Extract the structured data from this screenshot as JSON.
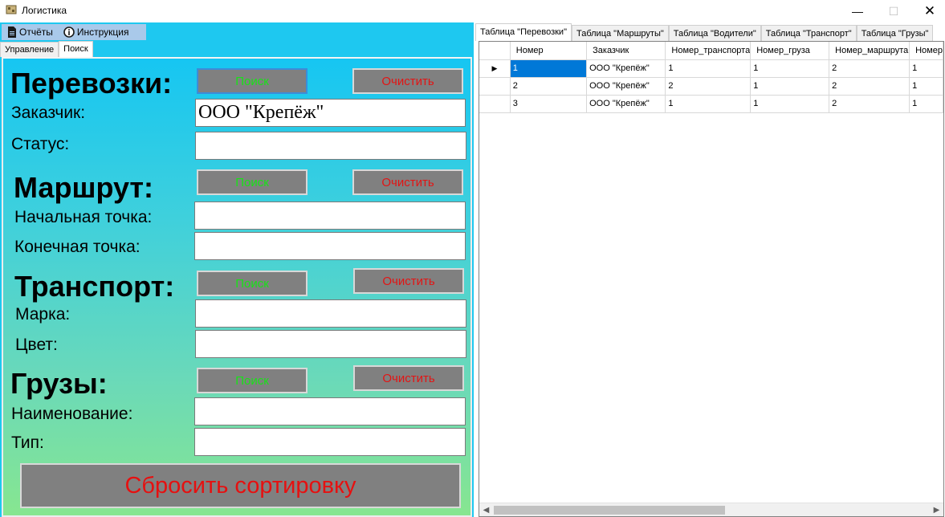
{
  "window": {
    "title": "Логистика",
    "minimize_glyph": "—",
    "maximize_glyph": "☐",
    "close_glyph": "✕"
  },
  "menu": {
    "reports": "Отчёты",
    "instruction": "Инструкция"
  },
  "left_tabs": [
    "Управление",
    "Поиск"
  ],
  "sections": {
    "transport_orders": {
      "title": "Перевозки:",
      "search": "Поиск",
      "clear": "Очистить",
      "customer_label": "Заказчик:",
      "customer_value": "ООО \"Крепёж\"",
      "status_label": "Статус:",
      "status_value": ""
    },
    "route": {
      "title": "Маршрут:",
      "search": "Поиск",
      "clear": "Очистить",
      "start_label": "Начальная точка:",
      "start_value": "",
      "end_label": "Конечная точка:",
      "end_value": ""
    },
    "vehicle": {
      "title": "Транспорт:",
      "search": "Поиск",
      "clear": "Очистить",
      "brand_label": "Марка:",
      "brand_value": "",
      "color_label": "Цвет:",
      "color_value": ""
    },
    "cargo": {
      "title": "Грузы:",
      "search": "Поиск",
      "clear": "Очистить",
      "name_label": "Наименование:",
      "name_value": "",
      "type_label": "Тип:",
      "type_value": ""
    }
  },
  "reset_button": "Сбросить сортировку",
  "right_tabs": [
    "Таблица \"Перевозки\"",
    "Таблица \"Маршруты\"",
    "Таблица \"Водители\"",
    "Таблица \"Транспорт\"",
    "Таблица \"Грузы\""
  ],
  "table": {
    "columns": [
      "Номер",
      "Заказчик",
      "Номер_транспорта",
      "Номер_груза",
      "Номер_маршрута",
      "Номер"
    ],
    "rows": [
      [
        "1",
        "ООО \"Крепёж\"",
        "1",
        "1",
        "2",
        "1"
      ],
      [
        "2",
        "ООО \"Крепёж\"",
        "2",
        "1",
        "2",
        "1"
      ],
      [
        "3",
        "ООО \"Крепёж\"",
        "1",
        "1",
        "2",
        "1"
      ]
    ],
    "current_row_marker": "▶"
  },
  "colors": {
    "search_text": "#17e317",
    "clear_text": "#e31414",
    "button_bg": "#808080",
    "selection": "#0078d7"
  },
  "icons": {
    "app": "app-icon",
    "reports": "document-icon",
    "instruction": "info-icon"
  }
}
